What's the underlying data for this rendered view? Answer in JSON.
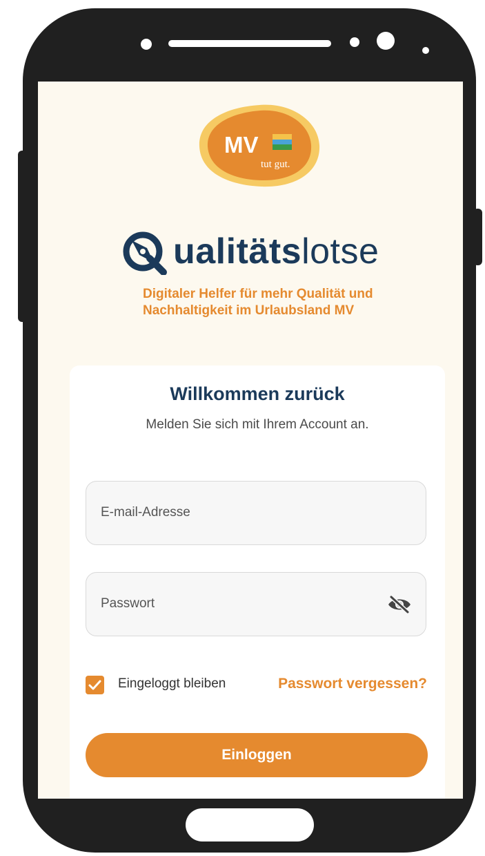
{
  "logo": {
    "mv_text": "MV",
    "slogan": "tut gut."
  },
  "brand": {
    "name_bold": "ualitäts",
    "name_light": "lotse"
  },
  "tagline": {
    "line1": "Digitaler Helfer für mehr Qualität und",
    "line2": "Nachhaltigkeit im Urlaubsland MV"
  },
  "login": {
    "title": "Willkommen zurück",
    "subtitle": "Melden Sie sich mit Ihrem Account an.",
    "email_placeholder": "E-mail-Adresse",
    "password_placeholder": "Passwort",
    "remember_label": "Eingeloggt bleiben",
    "remember_checked": true,
    "forgot_link": "Passwort vergessen?",
    "submit_label": "Einloggen"
  },
  "icons": {
    "password_toggle": "eye-slash-icon",
    "checkbox": "check-icon",
    "brand_mark": "q-compass-icon"
  },
  "colors": {
    "accent": "#e58a2f",
    "brand_navy": "#1b3a5a",
    "screen_bg": "#fdf9ef",
    "card_bg": "#ffffff",
    "phone_frame": "#202020"
  }
}
